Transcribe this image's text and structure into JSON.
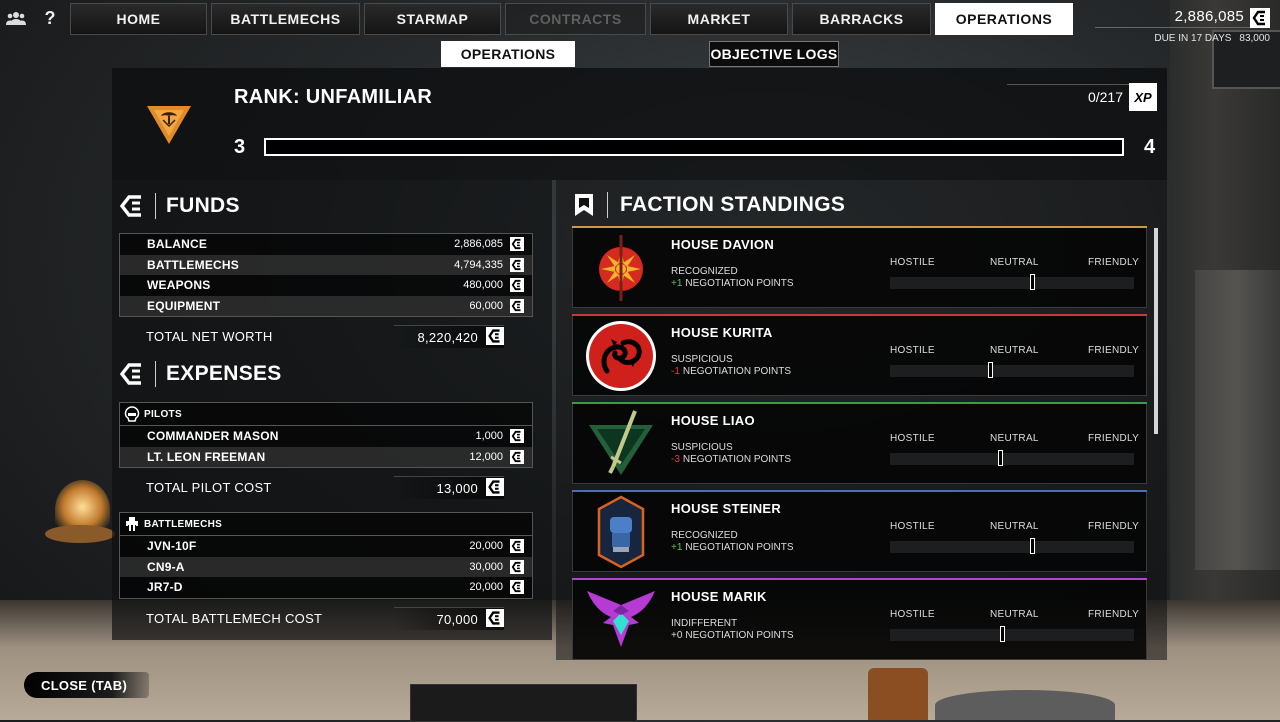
{
  "nav": {
    "tabs": [
      {
        "label": "HOME",
        "state": "normal"
      },
      {
        "label": "BATTLEMECHS",
        "state": "normal"
      },
      {
        "label": "STARMAP",
        "state": "normal"
      },
      {
        "label": "CONTRACTS",
        "state": "disabled"
      },
      {
        "label": "MARKET",
        "state": "normal"
      },
      {
        "label": "BARRACKS",
        "state": "normal"
      },
      {
        "label": "OPERATIONS",
        "state": "active"
      }
    ],
    "help_label": "?",
    "funds_value": "2,886,085",
    "due_label": "DUE IN 17 DAYS",
    "due_amount": "83,000"
  },
  "subtabs": {
    "active": "OPERATIONS",
    "other": "OBJECTIVE LOGS"
  },
  "rank": {
    "title": "RANK: UNFAMILIAR",
    "xp_value": "0/217",
    "xp_badge": "XP",
    "level_start": "3",
    "level_end": "4",
    "progress": 0
  },
  "funds": {
    "heading": "FUNDS",
    "rows": [
      {
        "label": "BALANCE",
        "value": "2,886,085"
      },
      {
        "label": "BATTLEMECHS",
        "value": "4,794,335"
      },
      {
        "label": "WEAPONS",
        "value": "480,000"
      },
      {
        "label": "EQUIPMENT",
        "value": "60,000"
      }
    ],
    "total_label": "TOTAL NET WORTH",
    "total_value": "8,220,420"
  },
  "expenses": {
    "heading": "EXPENSES",
    "pilots_title": "PILOTS",
    "pilots": [
      {
        "label": "COMMANDER MASON",
        "value": "1,000"
      },
      {
        "label": "LT. LEON FREEMAN",
        "value": "12,000"
      }
    ],
    "pilot_total_label": "TOTAL PILOT COST",
    "pilot_total_value": "13,000",
    "mechs_title": "BATTLEMECHS",
    "mechs": [
      {
        "label": "JVN-10F",
        "value": "20,000"
      },
      {
        "label": "CN9-A",
        "value": "30,000"
      },
      {
        "label": "JR7-D",
        "value": "20,000"
      }
    ],
    "mech_total_label": "TOTAL BATTLEMECH COST",
    "mech_total_value": "70,000"
  },
  "factions": {
    "heading": "FACTION STANDINGS",
    "scale": {
      "hostile": "HOSTILE",
      "neutral": "NEUTRAL",
      "friendly": "FRIENDLY"
    },
    "items": [
      {
        "name": "HOUSE DAVION",
        "status": "RECOGNIZED",
        "delta": "+1",
        "delta_color": "#5fc25f",
        "points_label": "NEGOTIATION POINTS",
        "accent": "#c89a4e",
        "standing": 0.58,
        "emblem": "davion-sunburst-icon"
      },
      {
        "name": "HOUSE KURITA",
        "status": "SUSPICIOUS",
        "delta": "-1",
        "delta_color": "#e04040",
        "points_label": "NEGOTIATION POINTS",
        "accent": "#c23b3b",
        "standing": 0.41,
        "emblem": "kurita-dragon-icon"
      },
      {
        "name": "HOUSE LIAO",
        "status": "SUSPICIOUS",
        "delta": "-3",
        "delta_color": "#e04040",
        "points_label": "NEGOTIATION POINTS",
        "accent": "#3f9a46",
        "standing": 0.45,
        "emblem": "liao-sword-icon"
      },
      {
        "name": "HOUSE STEINER",
        "status": "RECOGNIZED",
        "delta": "+1",
        "delta_color": "#5fc25f",
        "points_label": "NEGOTIATION POINTS",
        "accent": "#4a6fb3",
        "standing": 0.58,
        "emblem": "steiner-fist-icon"
      },
      {
        "name": "HOUSE MARIK",
        "status": "INDIFFERENT",
        "delta": "+0",
        "delta_color": "#dddddd",
        "points_label": "NEGOTIATION POINTS",
        "accent": "#b046c9",
        "standing": 0.46,
        "emblem": "marik-eagle-icon"
      }
    ]
  },
  "close_label": "CLOSE (TAB)"
}
